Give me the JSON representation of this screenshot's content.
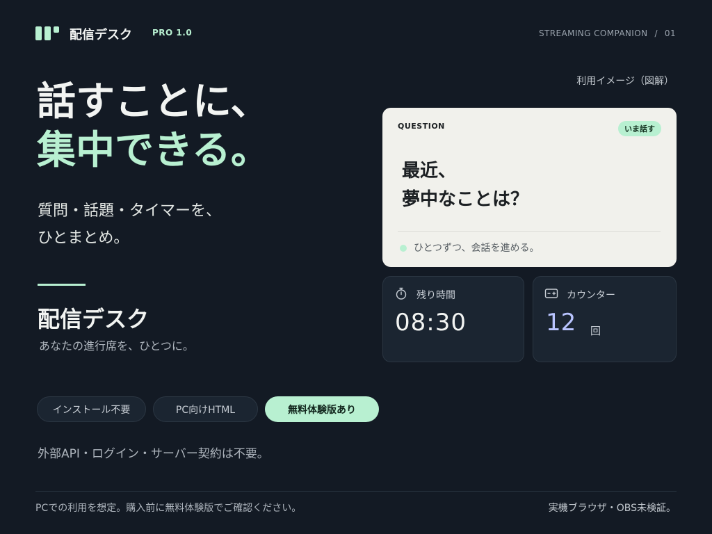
{
  "header": {
    "brand": "配信デスク",
    "version": "PRO 1.0",
    "section_label": "STREAMING COMPANION",
    "separator": "/",
    "page_number": "01",
    "logo_icon": "app-logo-icon"
  },
  "hero": {
    "headline_line1": "話すことに、",
    "headline_line2": "集中できる。",
    "sub_line1": "質問・話題・タイマーを、",
    "sub_line2": "ひとまとめ。",
    "app_name": "配信デスク",
    "tagline": "あなたの進行席を、ひとつに。"
  },
  "chips": [
    {
      "label": "インストール不要"
    },
    {
      "label": "PC向けHTML"
    },
    {
      "label": "無料体験版あり"
    }
  ],
  "note": "外部API・ログイン・サーバー契約は不要。",
  "preview": {
    "caption": "利用イメージ（図解）",
    "question_card": {
      "label": "QUESTION",
      "badge": "いま話す",
      "question_line1": "最近、",
      "question_line2": "夢中なことは？",
      "hint": "ひとつずつ、会話を進める。"
    },
    "timer_card": {
      "icon": "stopwatch-icon",
      "label": "残り時間",
      "value": "08:30"
    },
    "counter_card": {
      "icon": "counter-icon",
      "label": "カウンター",
      "value": "12",
      "unit": "回"
    }
  },
  "footer": {
    "left": "PCでの利用を想定。購入前に無料体験版でご確認ください。",
    "right": "実機ブラウザ・OBS未検証。"
  },
  "colors": {
    "background": "#131a24",
    "accent": "#b8f0d1",
    "card_light": "#f1f1ec",
    "card_dark": "#1b2531",
    "counter_value": "#b9c4ff"
  }
}
